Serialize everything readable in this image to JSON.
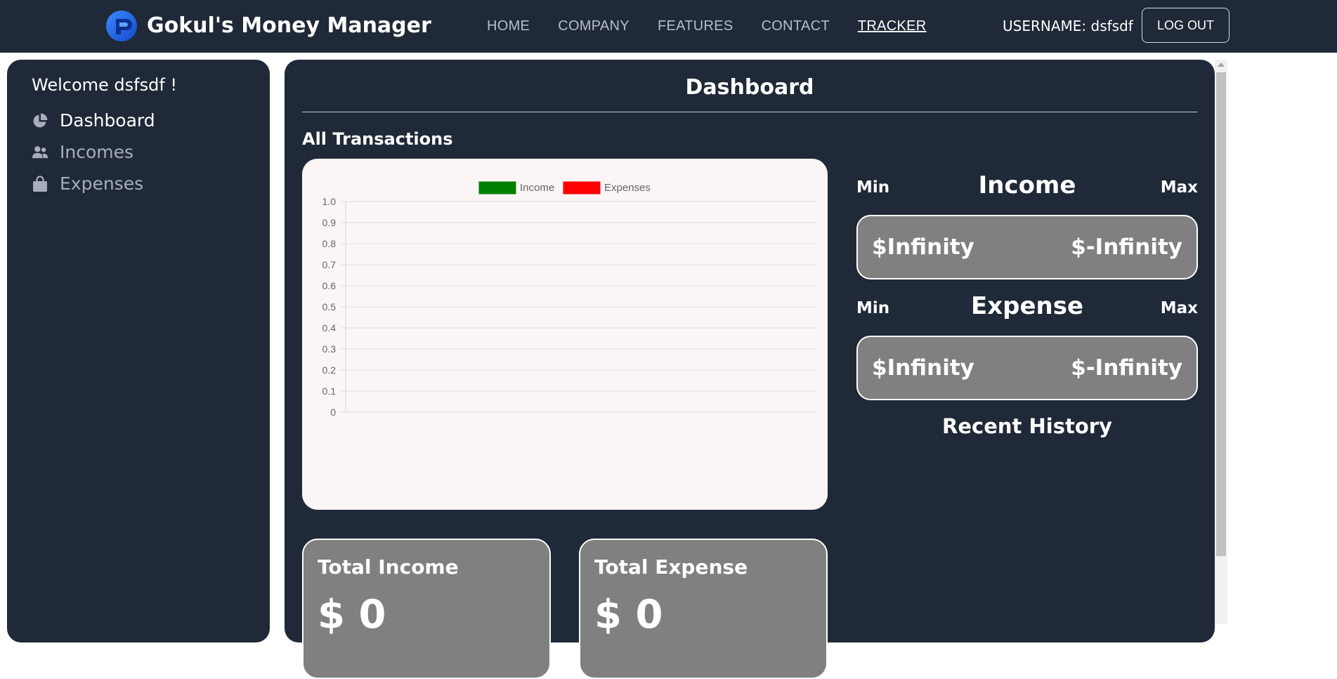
{
  "navbar": {
    "brand": "Gokul's Money Manager",
    "links": [
      "HOME",
      "COMPANY",
      "FEATURES",
      "CONTACT",
      "TRACKER"
    ],
    "active_link": "TRACKER",
    "username": "USERNAME: dsfsdf",
    "logout_label": "LOG OUT"
  },
  "sidebar": {
    "welcome": "Welcome dsfsdf !",
    "items": [
      {
        "label": "Dashboard",
        "icon": "pie-chart-icon",
        "active": true
      },
      {
        "label": "Incomes",
        "icon": "users-icon",
        "active": false
      },
      {
        "label": "Expenses",
        "icon": "shopping-bag-icon",
        "active": false
      }
    ]
  },
  "main": {
    "title": "Dashboard",
    "section_title": "All Transactions",
    "total_income": {
      "label": "Total Income",
      "value": "$ 0"
    },
    "total_expense": {
      "label": "Total Expense",
      "value": "$ 0"
    },
    "income_range": {
      "min_label": "Min",
      "heading": "Income",
      "max_label": "Max",
      "min_value": "$Infinity",
      "max_value": "$-Infinity"
    },
    "expense_range": {
      "min_label": "Min",
      "heading": "Expense",
      "max_label": "Max",
      "min_value": "$Infinity",
      "max_value": "$-Infinity"
    },
    "recent_history": "Recent History"
  },
  "colors": {
    "panel": "#1f2937",
    "card_grey": "#808080",
    "chart_bg": "#fbf5f6",
    "income": "#008000",
    "expenses": "#ff0000"
  },
  "chart_data": {
    "type": "line",
    "x": [],
    "series": [
      {
        "name": "Income",
        "values": [],
        "color": "#008000"
      },
      {
        "name": "Expenses",
        "values": [],
        "color": "#ff0000"
      }
    ],
    "ylim": [
      0,
      1.0
    ],
    "yticks": [
      "1.0",
      "0.9",
      "0.8",
      "0.7",
      "0.6",
      "0.5",
      "0.4",
      "0.3",
      "0.2",
      "0.1",
      "0"
    ],
    "grid": true,
    "legend": "top-center"
  }
}
